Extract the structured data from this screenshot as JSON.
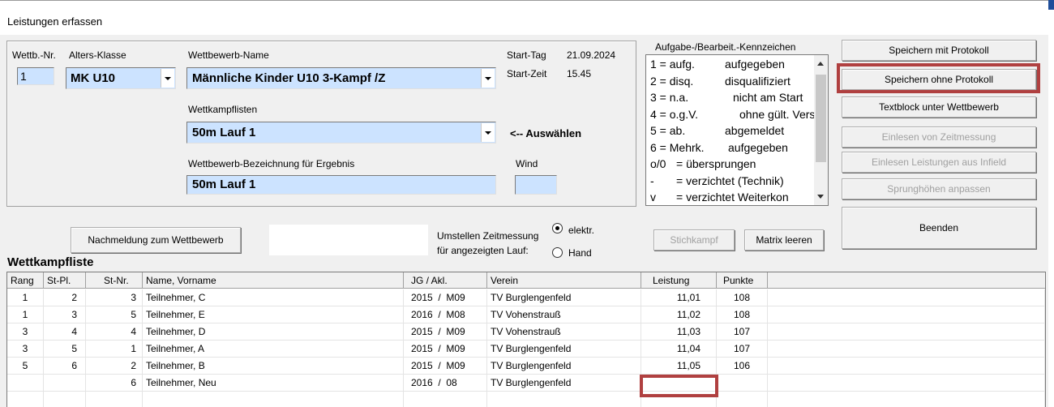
{
  "window": {
    "title": "Leistungen erfassen"
  },
  "form": {
    "wettb_nr_label": "Wettb.-Nr.",
    "wettb_nr_value": "1",
    "alters_klasse_label": "Alters-Klasse",
    "alters_klasse_value": "MK U10",
    "wettbewerb_name_label": "Wettbewerb-Name",
    "wettbewerb_name_value": "Männliche Kinder U10  3-Kampf /Z",
    "start_tag_label": "Start-Tag",
    "start_tag_value": "21.09.2024",
    "start_zeit_label": "Start-Zeit",
    "start_zeit_value": "15.45",
    "wettkampflisten_label": "Wettkampflisten",
    "wettkampflisten_value": "50m   Lauf 1",
    "auswaehlen_hint": "<-- Auswählen",
    "bezeichnung_label": "Wettbewerb-Bezeichnung für Ergebnis",
    "bezeichnung_value": "50m   Lauf 1",
    "wind_label": "Wind",
    "wind_value": ""
  },
  "kennzeichen": {
    "title": "Aufgabe-/Bearbeit.-Kennzeichen",
    "items": [
      {
        "code": "1 = aufg.",
        "text": "aufgegeben"
      },
      {
        "code": "2 = disq.",
        "text": "disqualifiziert"
      },
      {
        "code": "3 = n.a.",
        "text": "nicht am Start"
      },
      {
        "code": "4 = o.g.V.",
        "text": "ohne gült. Vers"
      },
      {
        "code": "5 = ab.",
        "text": "abgemeldet"
      },
      {
        "code": "6 = Mehrk.",
        "text": "aufgegeben"
      },
      {
        "code": "o/0",
        "text": "= übersprungen"
      },
      {
        "code": "-",
        "text": "= verzichtet (Technik)"
      },
      {
        "code": "v",
        "text": "= verzichtet Weiterkon"
      }
    ]
  },
  "buttons": {
    "speichern_mit": "Speichern mit Protokoll",
    "speichern_ohne": "Speichern ohne Protokoll",
    "textblock": "Textblock unter Wettbewerb",
    "einlesen_zeit": "Einlesen von Zeitmessung",
    "einlesen_infield": "Einlesen Leistungen aus Infield",
    "sprunghoehen": "Sprunghöhen anpassen",
    "beenden": "Beenden",
    "nachmeldung": "Nachmeldung zum Wettbewerb",
    "stichkampf": "Stichkampf",
    "matrix_leeren": "Matrix leeren"
  },
  "zeitmessung": {
    "label_line1": "Umstellen Zeitmessung",
    "label_line2": "für angezeigten Lauf:",
    "option_elektr": "elektr.",
    "option_hand": "Hand",
    "selected": "elektr."
  },
  "table": {
    "title": "Wettkampfliste",
    "headers": {
      "rang": "Rang",
      "st_pl": "St-Pl.",
      "st_nr": "St-Nr.",
      "name": "Name, Vorname",
      "jg_akl": "JG  /  Akl.",
      "verein": "Verein",
      "leistung": "Leistung",
      "punkte": "Punkte"
    },
    "rows": [
      {
        "rang": "1",
        "st_pl": "2",
        "st_nr": "3",
        "name": "Teilnehmer, C",
        "jg": "2015",
        "akl": "M09",
        "verein": "TV Burglengenfeld",
        "leistung": "11,01",
        "punkte": "108"
      },
      {
        "rang": "1",
        "st_pl": "3",
        "st_nr": "5",
        "name": "Teilnehmer, E",
        "jg": "2016",
        "akl": "M08",
        "verein": "TV Vohenstrauß",
        "leistung": "11,02",
        "punkte": "108"
      },
      {
        "rang": "3",
        "st_pl": "4",
        "st_nr": "4",
        "name": "Teilnehmer, D",
        "jg": "2015",
        "akl": "M09",
        "verein": "TV Vohenstrauß",
        "leistung": "11,03",
        "punkte": "107"
      },
      {
        "rang": "3",
        "st_pl": "5",
        "st_nr": "1",
        "name": "Teilnehmer, A",
        "jg": "2015",
        "akl": "M09",
        "verein": "TV Burglengenfeld",
        "leistung": "11,04",
        "punkte": "107"
      },
      {
        "rang": "5",
        "st_pl": "6",
        "st_nr": "2",
        "name": "Teilnehmer, B",
        "jg": "2015",
        "akl": "M09",
        "verein": "TV Burglengenfeld",
        "leistung": "11,05",
        "punkte": "106"
      },
      {
        "rang": "",
        "st_pl": "",
        "st_nr": "6",
        "name": "Teilnehmer, Neu",
        "jg": "2016",
        "akl": "08",
        "verein": "TV Burglengenfeld",
        "leistung": "",
        "punkte": ""
      }
    ]
  },
  "colors": {
    "field_bg": "#cce3ff",
    "highlight": "#b04040",
    "window_bg": "#f0f0f0"
  }
}
